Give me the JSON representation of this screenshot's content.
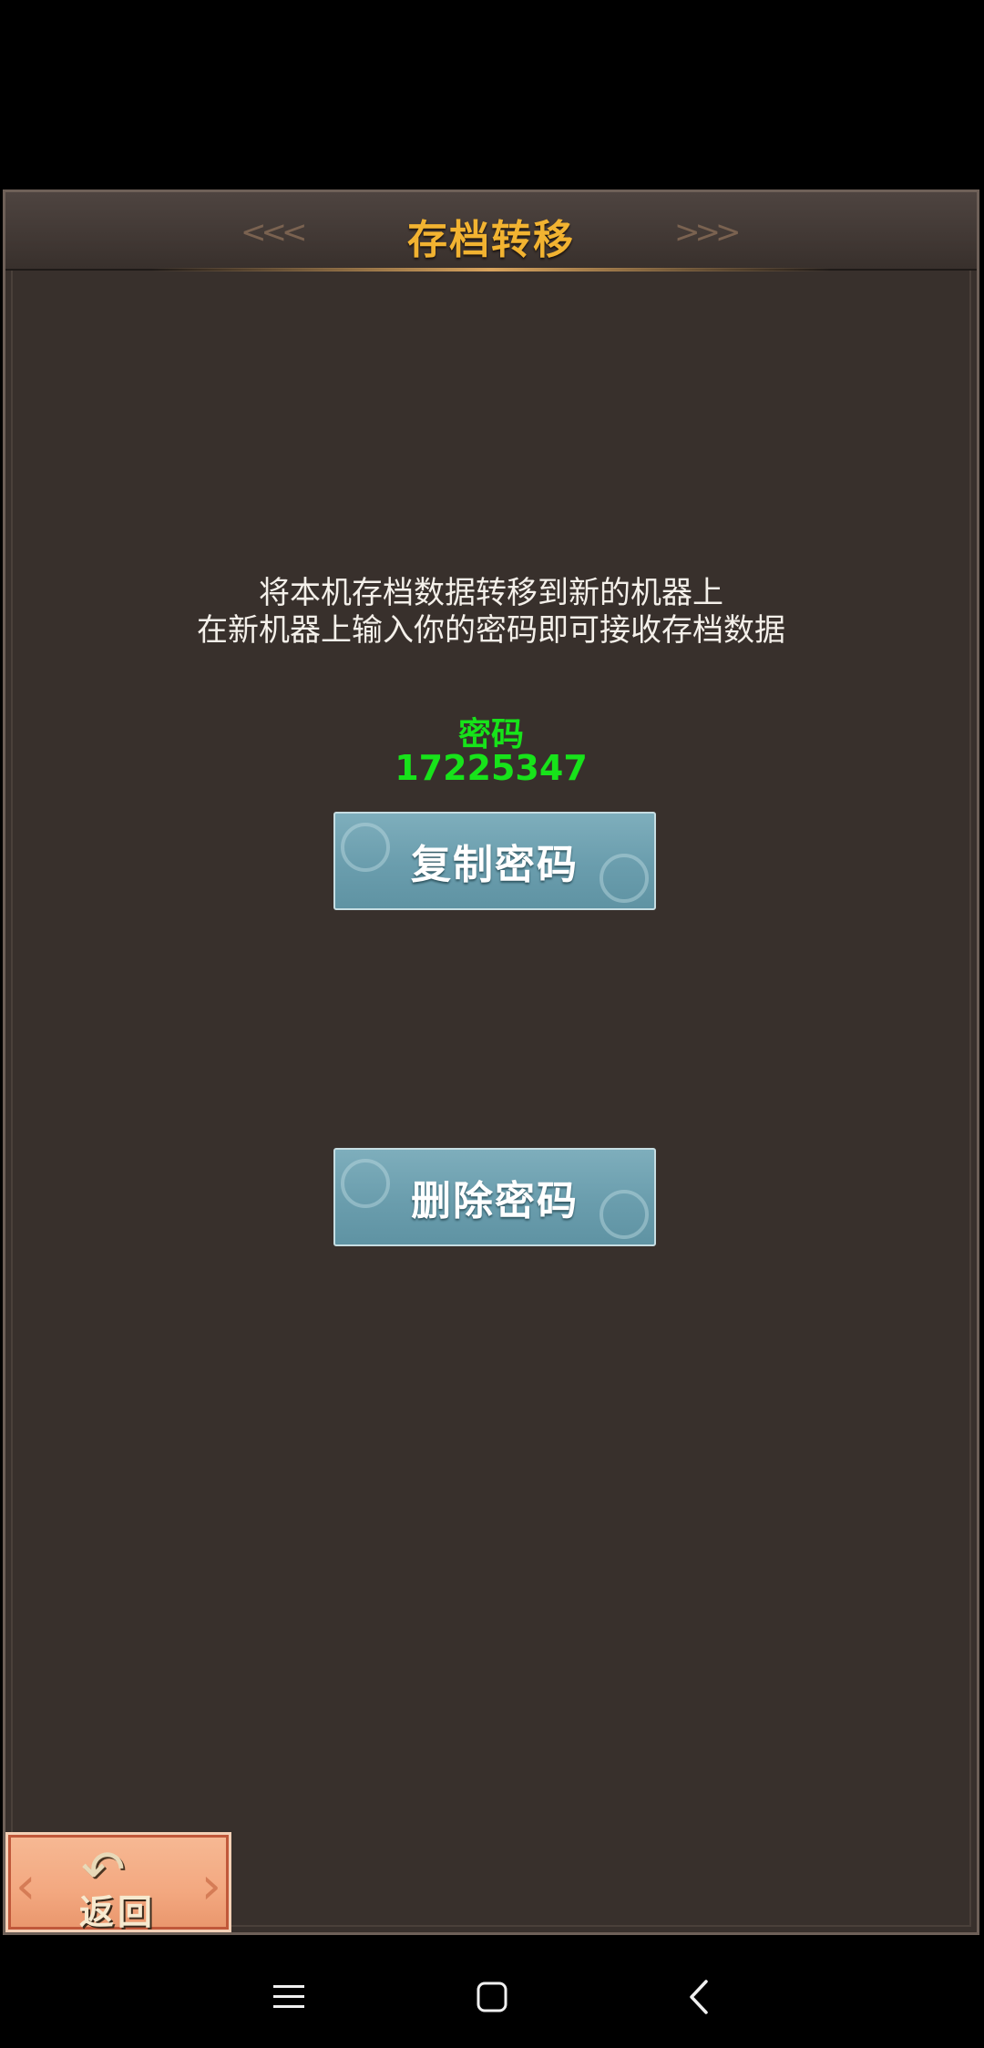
{
  "title": "存档转移",
  "instructions": {
    "line1": "将本机存档数据转移到新的机器上",
    "line2": "在新机器上输入你的密码即可接收存档数据"
  },
  "password": {
    "label": "密码",
    "value": "17225347"
  },
  "buttons": {
    "copy_label": "复制密码",
    "delete_label": "删除密码"
  },
  "back_button": {
    "label": "返回",
    "icon": "back-arrow-icon"
  },
  "system_nav": {
    "menu_icon": "menu-icon",
    "home_icon": "home-icon",
    "back_icon": "chevron-left-icon"
  },
  "colors": {
    "title": "#f2b331",
    "password": "#17e31a",
    "button": "#6a9dad",
    "back_button": "#f3a880",
    "panel": "#38302c"
  }
}
